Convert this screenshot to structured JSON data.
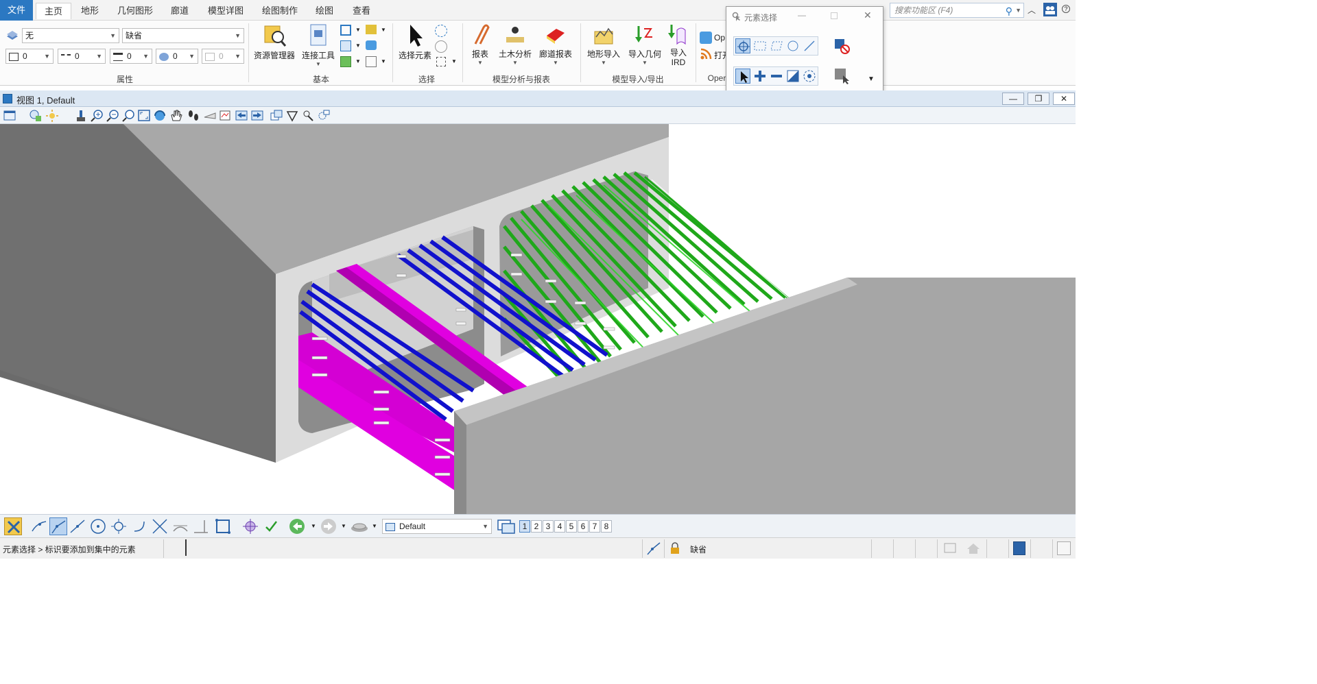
{
  "ribbon": {
    "tabs": [
      "文件",
      "主页",
      "地形",
      "几何图形",
      "廊道",
      "模型详图",
      "绘图制作",
      "绘图",
      "查看"
    ],
    "active_tab": "主页",
    "search_placeholder": "搜索功能区 (F4)"
  },
  "attributes": {
    "level": "无",
    "style": "缺省",
    "color": "0",
    "weight": "0",
    "linestyle": "0",
    "transparency": "0",
    "priority": "0",
    "group_label": "属性"
  },
  "groups": {
    "basic": {
      "label": "基本",
      "buttons": [
        "资源管理器",
        "连接工具"
      ]
    },
    "select": {
      "label": "选择",
      "buttons": [
        "选择元素"
      ]
    },
    "analysis": {
      "label": "模型分析与报表",
      "buttons": [
        "报表",
        "土木分析",
        "廊道报表"
      ]
    },
    "import_export": {
      "label": "模型导入/导出",
      "buttons": [
        "地形导入",
        "导入几何",
        "导入 IRD"
      ]
    },
    "open": {
      "label": "Oper",
      "buttons": [
        "Op",
        "打开"
      ]
    }
  },
  "popup": {
    "title": "元素选择"
  },
  "view": {
    "title": "视图 1, Default",
    "scene": {
      "tunnel_color": "#a9a9a9",
      "magenta_pipe": "#e100e1",
      "blue_pipe": "#1414d6",
      "green_pipe": "#22c21c"
    }
  },
  "bottom": {
    "view_group": "Default",
    "view_numbers": [
      "1",
      "2",
      "3",
      "4",
      "5",
      "6",
      "7",
      "8"
    ],
    "selected_view": "1"
  },
  "status": {
    "prompt": "元素选择 > 标识要添加到集中的元素",
    "style": "缺省"
  }
}
